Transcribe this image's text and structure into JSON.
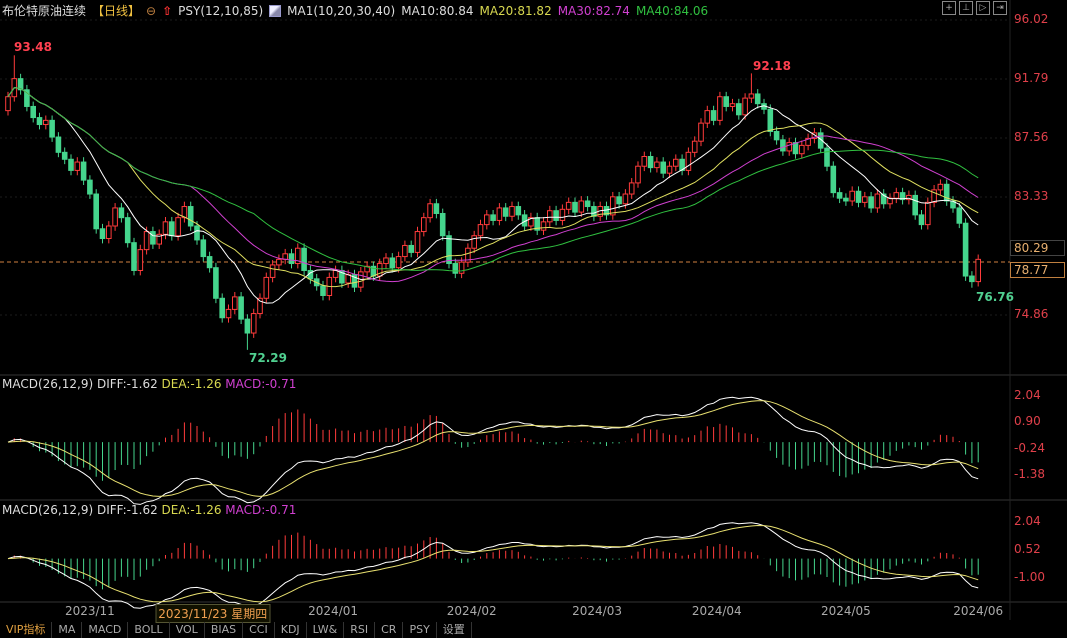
{
  "header": {
    "title": "布伦特原油连续",
    "period": "【日线】",
    "indicator1": "PSY(12,10,85)",
    "ma_label": "MA1(10,20,30,40)",
    "ma10": "MA10:80.84",
    "ma20": "MA20:81.82",
    "ma30": "MA30:82.74",
    "ma40": "MA40:84.06",
    "tools": [
      "crosshair-icon",
      "fit-icon",
      "play-icon",
      "goto-end-icon"
    ]
  },
  "colors": {
    "up": "#ff3b3b",
    "down": "#45d58d",
    "ma10": "#ffffff",
    "ma20": "#e0e060",
    "ma30": "#d040d0",
    "ma40": "#30c040",
    "axis": "#e0404a",
    "diff": "#ffffff",
    "dea": "#e8e070"
  },
  "price_axis": [
    "96.02",
    "91.79",
    "87.56",
    "83.33",
    "74.86"
  ],
  "price_boxes": {
    "cursor": "80.29",
    "last": "78.77"
  },
  "annotations": {
    "high1": "93.48",
    "high2": "92.18",
    "low1": "72.29",
    "low2": "76.76"
  },
  "macd1": {
    "title": "MACD(26,12,9)",
    "diff": "DIFF:-1.62",
    "dea": "DEA:-1.26",
    "macd": "MACD:-0.71",
    "axis": [
      "2.04",
      "0.90",
      "-0.24",
      "-1.38"
    ]
  },
  "macd2": {
    "title": "MACD(26,12,9)",
    "diff": "DIFF:-1.62",
    "dea": "DEA:-1.26",
    "macd": "MACD:-0.71",
    "axis": [
      "2.04",
      "0.52",
      "-1.00"
    ]
  },
  "dates": {
    "ticks": [
      {
        "label": "2023/11",
        "index": 13
      },
      {
        "label": "2024/01",
        "index": 51.6
      },
      {
        "label": "2024/02",
        "index": 73.6
      },
      {
        "label": "2024/03",
        "index": 93.5
      },
      {
        "label": "2024/04",
        "index": 112.5
      },
      {
        "label": "2024/05",
        "index": 133
      },
      {
        "label": "2024/06",
        "index": 154
      }
    ],
    "cursor": {
      "label": "2023/11/23 星期四",
      "index": 32.5
    }
  },
  "tabs": [
    "VIP指标",
    "MA",
    "MACD",
    "BOLL",
    "VOL",
    "BIAS",
    "CCI",
    "KDJ",
    "LW&",
    "RSI",
    "CR",
    "PSY",
    "设置"
  ],
  "chart_data": {
    "type": "candlestick",
    "title": "布伦特原油连续",
    "ylim": [
      74.86,
      96.02
    ],
    "extremes": {
      "high": [
        {
          "index": 1,
          "value": 93.48
        },
        {
          "index": 118,
          "value": 92.18
        }
      ],
      "low": [
        {
          "index": 38,
          "value": 72.29
        },
        {
          "index": 153,
          "value": 76.76
        }
      ]
    },
    "last_price": 78.77,
    "first_open": 89.5,
    "close": [
      90.5,
      91.8,
      91.0,
      89.8,
      89.0,
      88.5,
      88.8,
      87.6,
      86.5,
      86.0,
      85.2,
      85.8,
      84.5,
      83.5,
      81.0,
      80.3,
      81.2,
      82.5,
      81.8,
      80.0,
      78.0,
      79.5,
      80.8,
      79.9,
      80.6,
      81.5,
      80.5,
      81.8,
      82.6,
      81.2,
      80.2,
      79.0,
      78.2,
      76.0,
      74.6,
      75.2,
      76.1,
      74.5,
      73.5,
      74.9,
      76.0,
      77.5,
      78.4,
      78.8,
      79.2,
      78.5,
      79.6,
      78.0,
      77.4,
      76.9,
      76.2,
      77.5,
      78.0,
      77.1,
      77.7,
      76.8,
      77.9,
      78.3,
      77.6,
      78.5,
      78.9,
      78.2,
      79.0,
      79.8,
      79.3,
      80.8,
      81.8,
      82.8,
      82.1,
      80.5,
      78.5,
      77.8,
      78.6,
      79.6,
      80.5,
      81.3,
      82.0,
      81.6,
      82.5,
      81.9,
      82.6,
      82.0,
      81.2,
      81.8,
      80.9,
      81.5,
      82.3,
      81.6,
      82.4,
      82.9,
      82.2,
      83.0,
      82.6,
      81.9,
      82.6,
      82.0,
      83.3,
      82.8,
      83.5,
      84.3,
      85.5,
      86.2,
      85.4,
      85.8,
      85.0,
      85.5,
      86.0,
      85.2,
      86.5,
      87.3,
      88.6,
      89.5,
      88.8,
      90.5,
      89.8,
      90.0,
      89.2,
      90.4,
      90.7,
      90.0,
      89.6,
      88.0,
      87.4,
      86.6,
      87.2,
      86.4,
      87.0,
      87.5,
      87.9,
      86.8,
      85.5,
      83.6,
      83.2,
      83.0,
      83.7,
      82.9,
      83.3,
      82.5,
      83.5,
      82.8,
      83.2,
      83.6,
      83.1,
      83.4,
      82.0,
      81.3,
      82.9,
      83.8,
      84.2,
      83.0,
      82.5,
      81.4,
      77.6,
      77.2,
      78.8
    ],
    "moving_averages": [
      10,
      20,
      30,
      40
    ],
    "macd_params": [
      26,
      12,
      9
    ]
  }
}
